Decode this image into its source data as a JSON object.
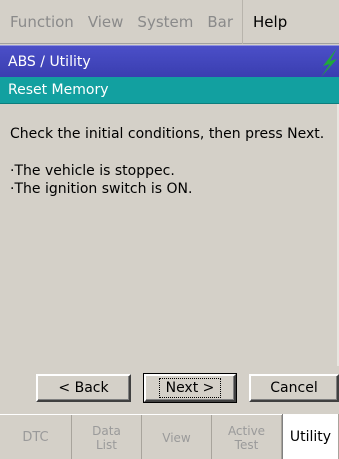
{
  "menu": {
    "items": [
      "Function",
      "View",
      "System",
      "Bar"
    ],
    "help": "Help"
  },
  "breadcrumb": "ABS / Utility",
  "screen_title": "Reset Memory",
  "content": {
    "instruction": "Check the initial conditions, then press Next.",
    "conditions": [
      "·The vehicle is stoppec.",
      "·The ignition switch is ON."
    ]
  },
  "buttons": {
    "back": "< Back",
    "next": "Next >",
    "cancel": "Cancel"
  },
  "tabs": {
    "dtc": "DTC",
    "data_list_1": "Data",
    "data_list_2": "List",
    "view": "View",
    "active_test_1": "Active",
    "active_test_2": "Test",
    "utility": "Utility"
  },
  "colors": {
    "breadcrumb_bg": "#3e42b8",
    "title_bg": "#12a0a0",
    "bolt": "#1fa83a"
  },
  "icons": {
    "status": "lightning-bolt-icon"
  }
}
